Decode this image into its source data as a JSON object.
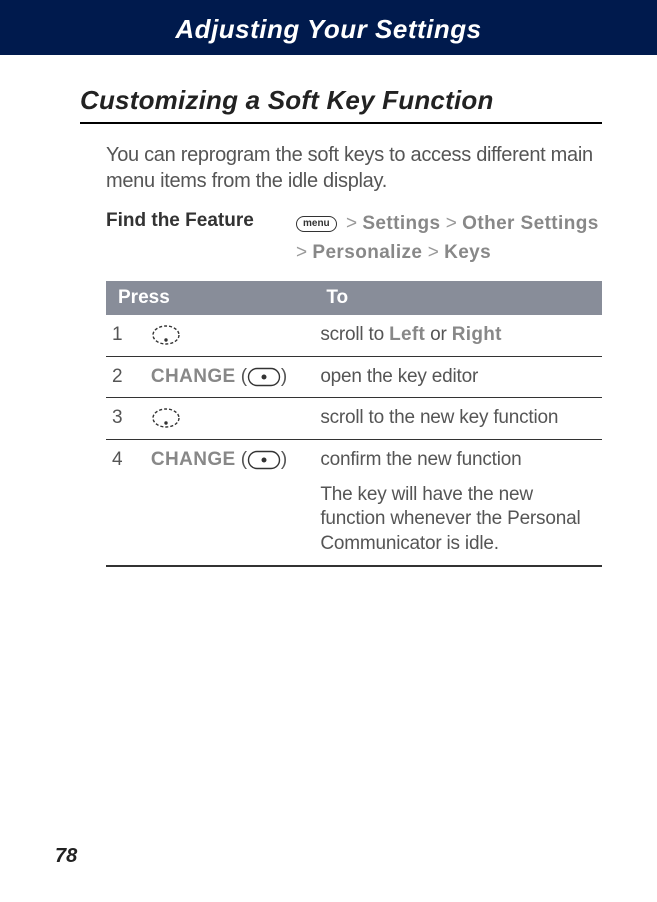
{
  "header": {
    "title": "Adjusting Your Settings"
  },
  "section": {
    "title": "Customizing a Soft Key Function",
    "intro": "You can reprogram the soft keys to access different main menu items from the idle display."
  },
  "findFeature": {
    "label": "Find the Feature",
    "menuLabel": "menu",
    "path": [
      "Settings",
      "Other Settings",
      "Personalize",
      "Keys"
    ],
    "sep": ">"
  },
  "table": {
    "headers": {
      "press": "Press",
      "to": "To"
    },
    "rows": [
      {
        "num": "1",
        "press": {
          "type": "nav"
        },
        "to": "scroll to ",
        "toKey1": "Left",
        "toJoin": " or ",
        "toKey2": "Right"
      },
      {
        "num": "2",
        "press": {
          "type": "softkey",
          "label": "CHANGE"
        },
        "to": "open the key editor"
      },
      {
        "num": "3",
        "press": {
          "type": "nav"
        },
        "to": "scroll to the new key function"
      },
      {
        "num": "4",
        "press": {
          "type": "softkey",
          "label": "CHANGE"
        },
        "to": "confirm the new function",
        "toExtra": "The key will have the new function whenever the Personal Communicator is idle."
      }
    ]
  },
  "pageNumber": "78"
}
